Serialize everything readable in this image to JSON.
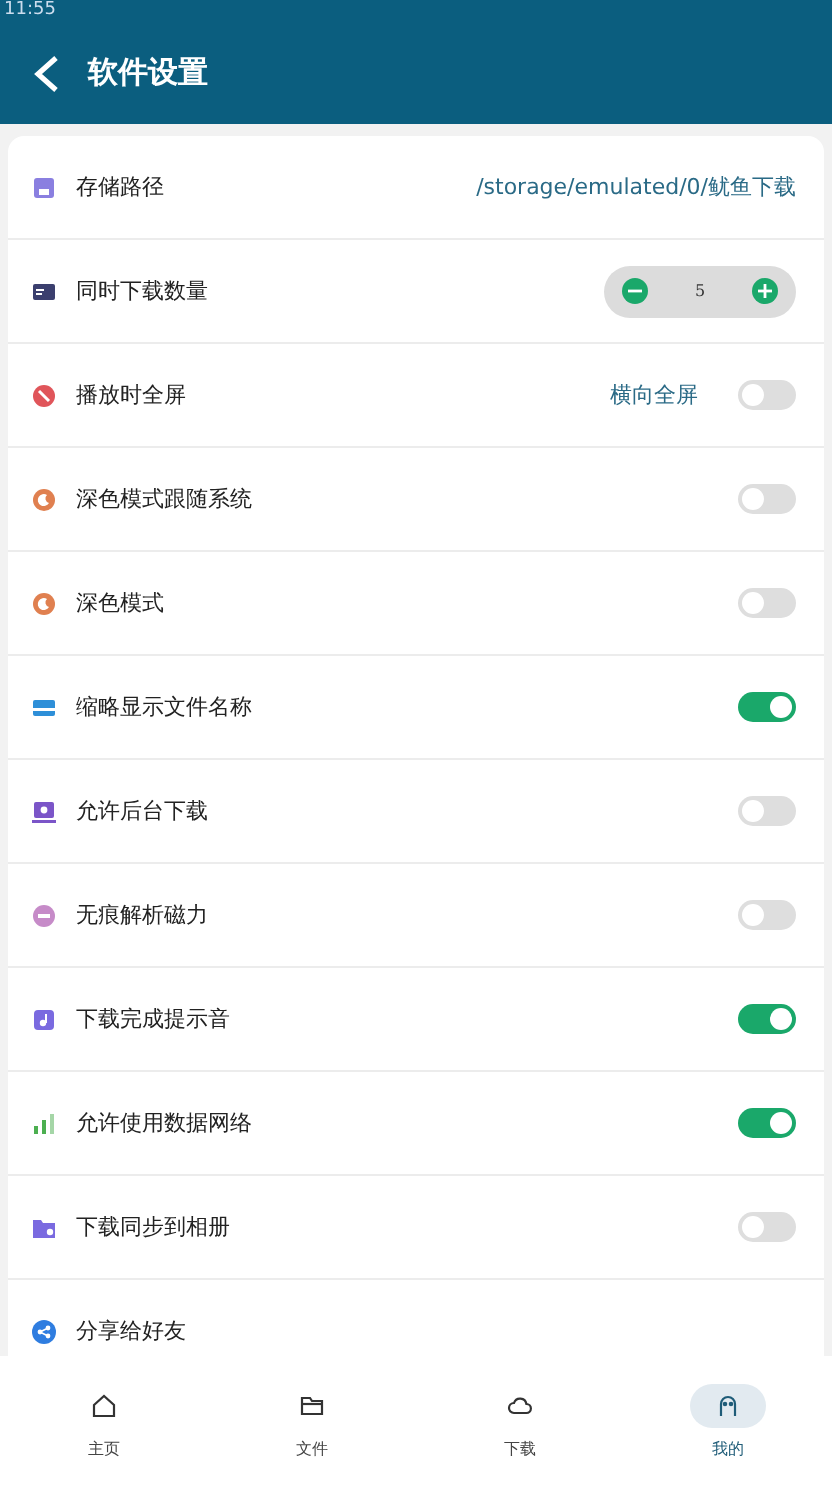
{
  "status_bar": {
    "time": "11:55"
  },
  "header": {
    "title": "软件设置"
  },
  "settings": [
    {
      "kind": "path",
      "label": "存储路径",
      "value": "/storage/emulated/0/鱿鱼下载"
    },
    {
      "kind": "stepper",
      "label": "同时下载数量",
      "value": "5"
    },
    {
      "kind": "toggle",
      "label": "播放时全屏",
      "value": "横向全屏",
      "on": false
    },
    {
      "kind": "toggle",
      "label": "深色模式跟随系统",
      "on": false
    },
    {
      "kind": "toggle",
      "label": "深色模式",
      "on": false
    },
    {
      "kind": "toggle",
      "label": "缩略显示文件名称",
      "on": true
    },
    {
      "kind": "toggle",
      "label": "允许后台下载",
      "on": false
    },
    {
      "kind": "toggle",
      "label": "无痕解析磁力",
      "on": false
    },
    {
      "kind": "toggle",
      "label": "下载完成提示音",
      "on": true
    },
    {
      "kind": "toggle",
      "label": "允许使用数据网络",
      "on": true
    },
    {
      "kind": "toggle",
      "label": "下载同步到相册",
      "on": false
    },
    {
      "kind": "link",
      "label": "分享给好友"
    }
  ],
  "bottom_nav": [
    {
      "label": "主页",
      "selected": false
    },
    {
      "label": "文件",
      "selected": false
    },
    {
      "label": "下载",
      "selected": false
    },
    {
      "label": "我的",
      "selected": true
    }
  ]
}
